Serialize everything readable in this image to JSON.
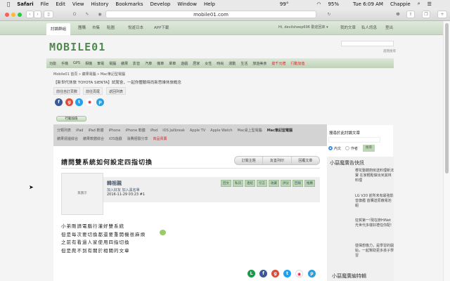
{
  "menubar": {
    "apple": "",
    "app": "Safari",
    "items": [
      "File",
      "Edit",
      "View",
      "History",
      "Bookmarks",
      "Develop",
      "Window",
      "Help"
    ],
    "temp": "99°",
    "battery": "95%",
    "clock": "Tue 6:09 AM",
    "user": "Chappie"
  },
  "browser": {
    "url": "mobile01.com"
  },
  "topnav": {
    "tabs": [
      "討論群組",
      "團購",
      "市集",
      "貼圖",
      "悅遊日本",
      "APP下載"
    ],
    "greeting": "Hi, devilsheep696 歡迎回來 ▾",
    "my_posts": "我的文章",
    "messages": "私人訊息",
    "logout": "登出"
  },
  "logo": "MOBILE01",
  "search": {
    "advanced": "進階搜尋"
  },
  "categories": [
    "功能",
    "手機",
    "GPS",
    "相機",
    "筆電",
    "電腦",
    "蘋果",
    "影音",
    "汽車",
    "機車",
    "單車",
    "遊戲",
    "居家",
    "女性",
    "時尚",
    "運動",
    "生活",
    "旅遊美食"
  ],
  "categories_red": [
    "搶千元禮",
    "行動加值"
  ],
  "breadcrumb": "Mobile01 首頁 » 蘋果電腦 » Mac筆記型電腦",
  "ad_line": "【新世代休旅 TOYOTA SIENTA】試駕會，一起你體驗時尚新思維休旅概念",
  "nav_buttons": [
    "前往自訂頁數",
    "前往頁尾",
    "返回列表"
  ],
  "mobile_topup": "行動加值",
  "subcategories": [
    "分類列表",
    "iPad",
    "iPad 軟體",
    "iPhone",
    "iPhone 軟體",
    "iPod",
    "iOS Jailbreak",
    "Apple TV",
    "Apple Watch",
    "Mac桌上型電腦",
    "Mac筆記型電腦",
    "蘋果週邊綜合",
    "蘋果軟體綜合",
    "iOS遊戲",
    "消費經驗分享",
    "商品買賣"
  ],
  "thread": {
    "title": "請問雙系統如何設定四指切換",
    "buttons": [
      "訂閱主題",
      "友善列印",
      "回覆文章"
    ]
  },
  "post": {
    "avatar_text": "無圖示",
    "author": "韓祖親",
    "links": "加入好友 加入黑名單",
    "time": "2016-11-29 03:23  #1",
    "actions": [
      "回文",
      "私訊",
      "連結",
      "引言",
      "收藏",
      "評分",
      "回報",
      "推薦"
    ],
    "body": [
      "小弟剛請電腦行灌好雙系統",
      "但是每次要切換都還要重開機很麻煩",
      "之前有看過人家使用四指切換",
      "但是爬不到有關於相關的文章"
    ]
  },
  "sidebar": {
    "search_title": "搜尋於此討論文章",
    "opt_content": "內文",
    "opt_author": "作者",
    "search_btn": "搜尋",
    "ad_title": "小惡魔廣告快訊",
    "ads": [
      "櫻花整體廚房送料理新法寶 在家輕鬆做出米其林料理",
      "LG V20 前所未有最強影音旗艦 首購送原廠電池組",
      "狂賀第一!現在辦HiNet光世代多樣好禮任你配!",
      "發揮想像力，是學習的開始，一起幫助更多孩子學習"
    ],
    "ad_title2": "小惡魔廣編特輯"
  },
  "colors": {
    "nav_green": "#c9d9c4",
    "logo_green": "#4f8a4f",
    "red": "#dd2222"
  }
}
